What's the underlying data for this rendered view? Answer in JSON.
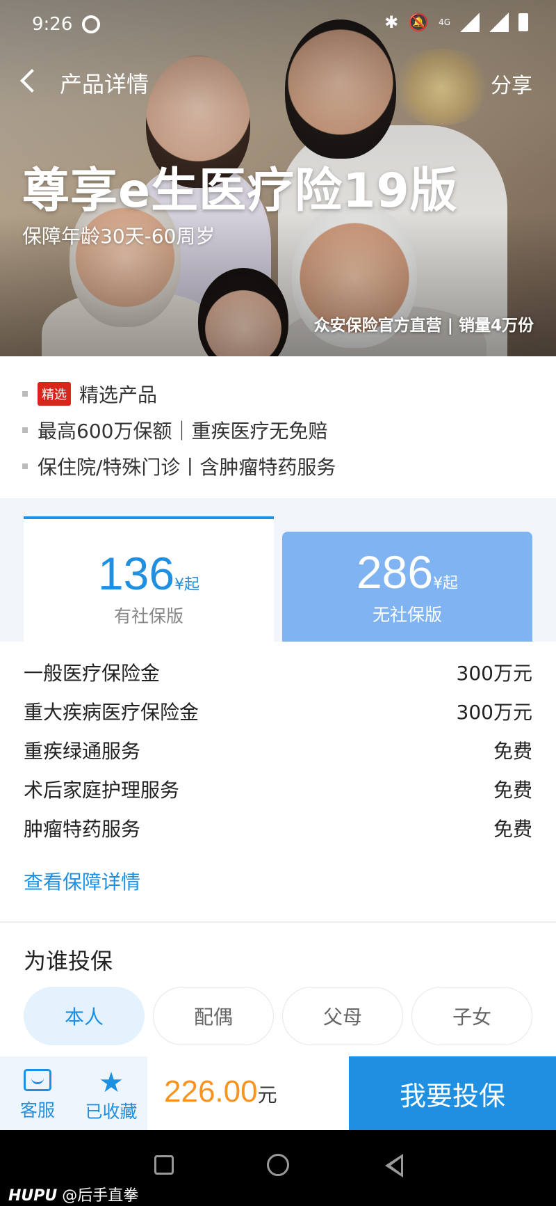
{
  "status": {
    "time": "9:26",
    "network": "4G"
  },
  "nav": {
    "title": "产品详情",
    "share": "分享"
  },
  "hero": {
    "title": "尊享e生医疗险19版",
    "subtitle": "保障年龄30天-60周岁",
    "tag": "众安保险官方直营 | 销量4万份"
  },
  "features": {
    "badge": "精选",
    "items": [
      "精选产品",
      "最高600万保额｜重疾医疗无免赔",
      "保住院/特殊门诊丨含肿瘤特药服务"
    ]
  },
  "plans": [
    {
      "price": "136",
      "unit": "¥起",
      "name": "有社保版",
      "selected": true
    },
    {
      "price": "286",
      "unit": "¥起",
      "name": "无社保版",
      "selected": false
    }
  ],
  "coverage": {
    "rows": [
      {
        "label": "一般医疗保险金",
        "value": "300万元"
      },
      {
        "label": "重大疾病医疗保险金",
        "value": "300万元"
      },
      {
        "label": "重疾绿通服务",
        "value": "免费"
      },
      {
        "label": "术后家庭护理服务",
        "value": "免费"
      },
      {
        "label": "肿瘤特药服务",
        "value": "免费"
      }
    ],
    "link": "查看保障详情"
  },
  "insured": {
    "title": "为谁投保",
    "options": [
      "本人",
      "配偶",
      "父母",
      "子女"
    ],
    "selected": "本人"
  },
  "bottom": {
    "service": "客服",
    "favorite": "已收藏",
    "price": "226.00",
    "price_unit": "元",
    "buy": "我要投保"
  },
  "watermark": {
    "brand": "HUPU",
    "user": "@后手直拳"
  },
  "colors": {
    "accent": "#1e8fe1",
    "price": "#f7931e",
    "badge": "#d9261c"
  }
}
